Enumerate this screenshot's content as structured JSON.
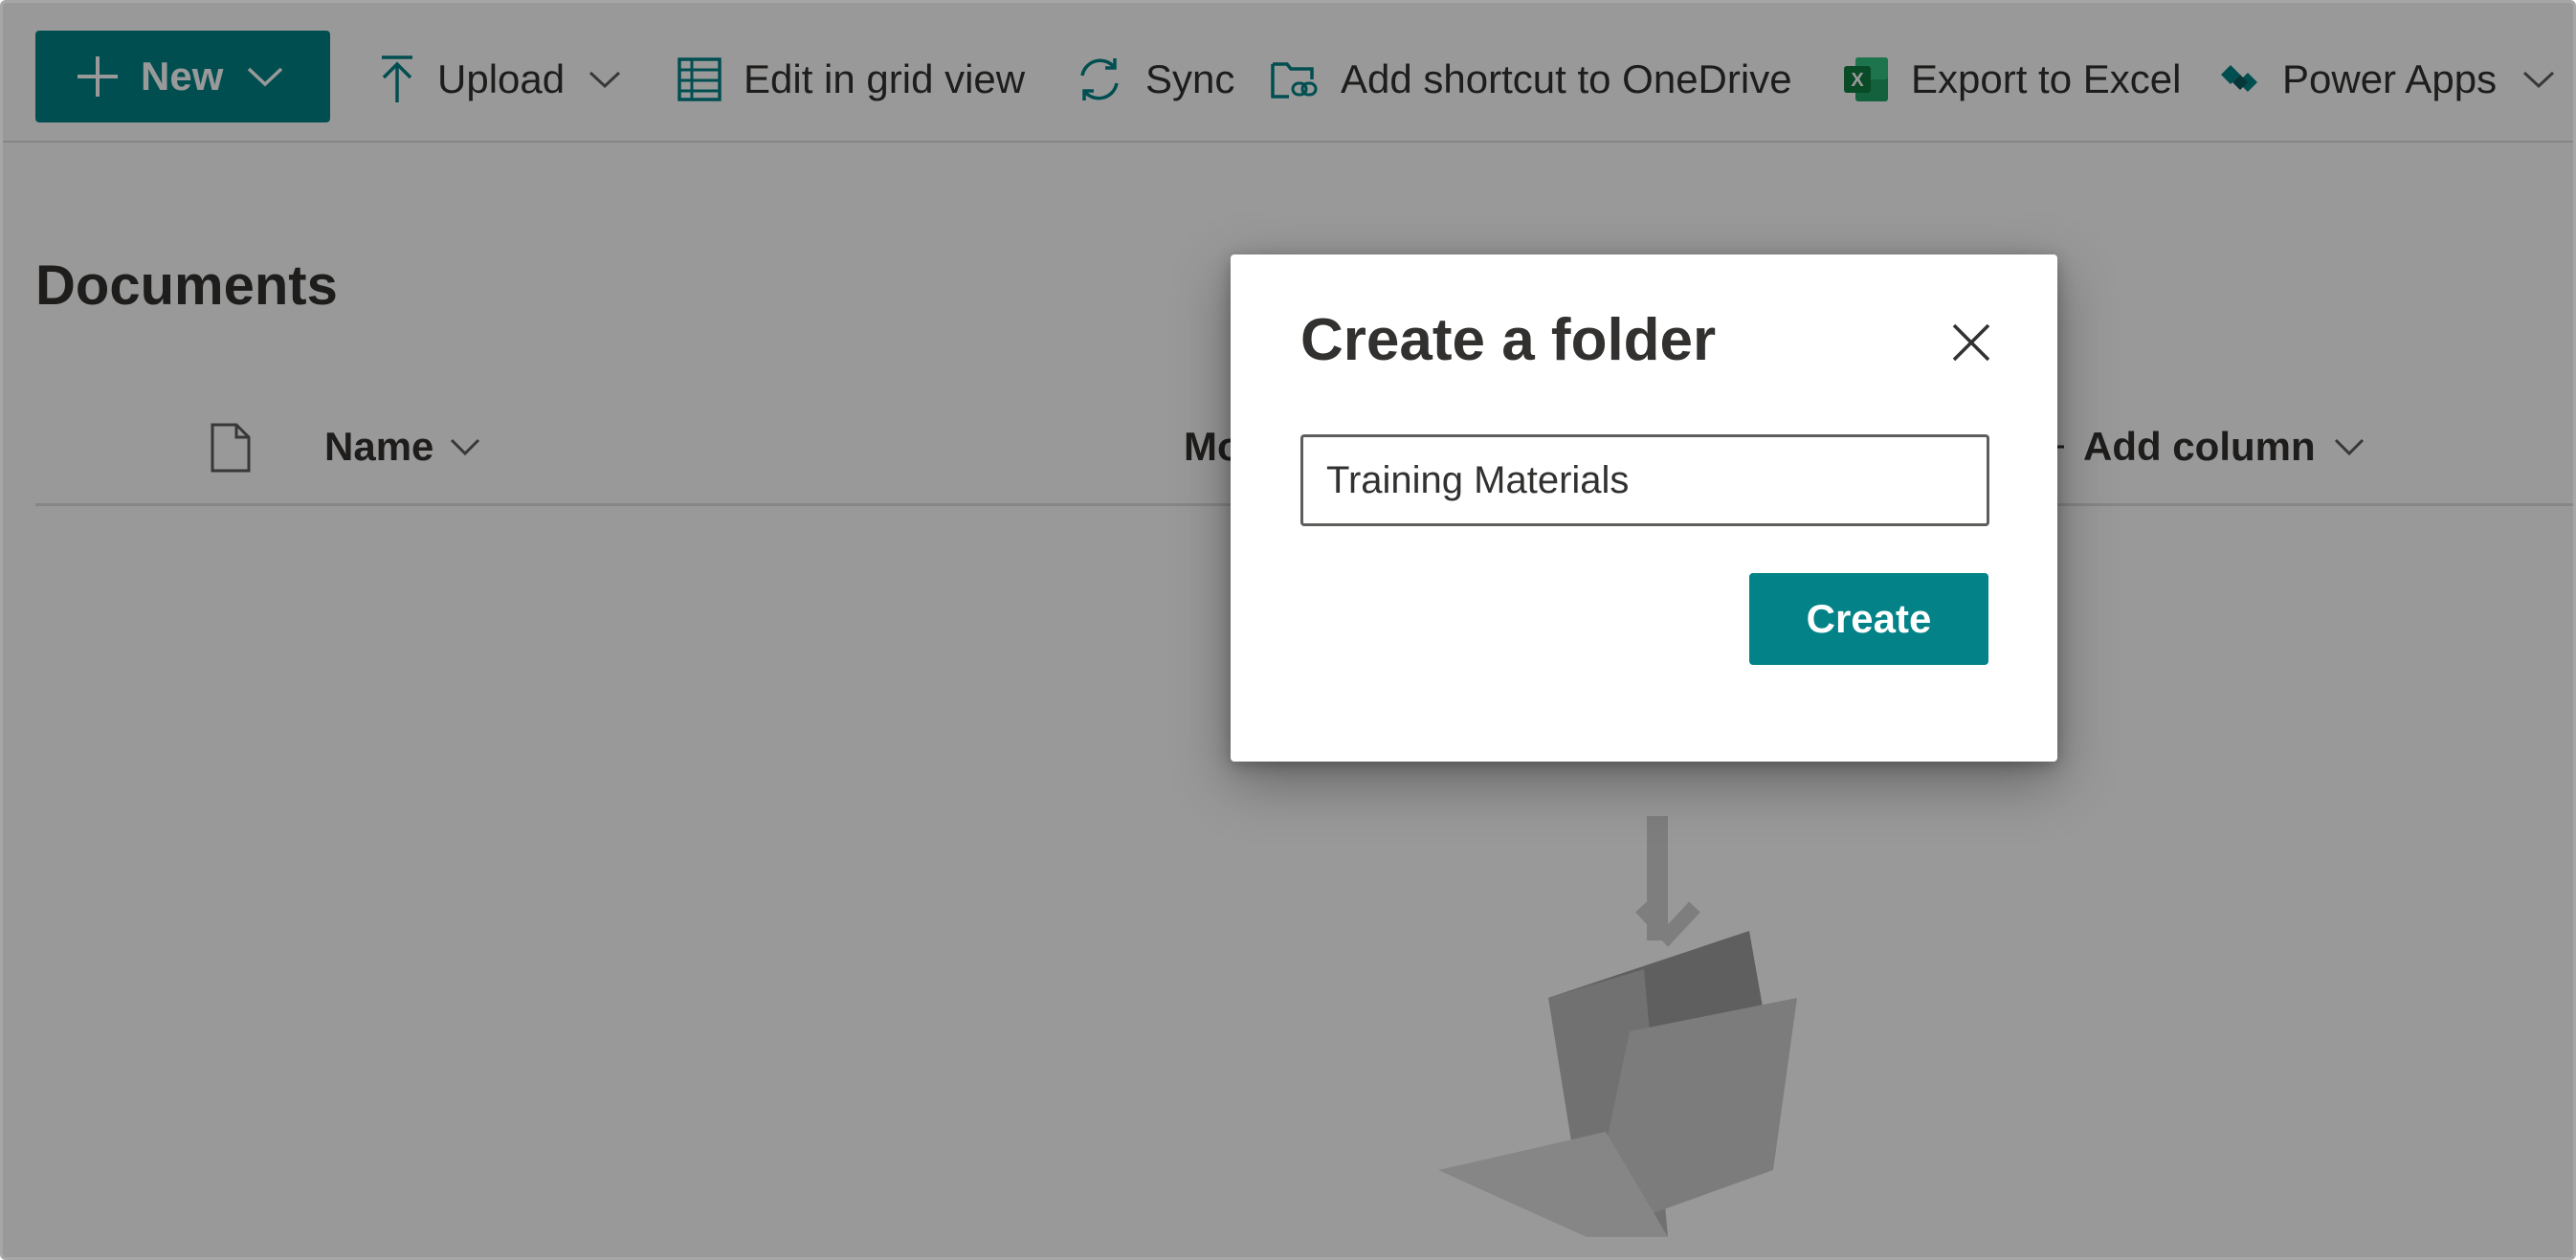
{
  "toolbar": {
    "new_label": "New",
    "upload_label": "Upload",
    "grid_view_label": "Edit in grid view",
    "sync_label": "Sync",
    "shortcut_label": "Add shortcut to OneDrive",
    "excel_label": "Export to Excel",
    "power_apps_label": "Power Apps"
  },
  "library": {
    "title": "Documents",
    "columns": {
      "name": "Name",
      "modified_partial": "Mo",
      "add_column": "Add column"
    }
  },
  "dialog": {
    "title": "Create a folder",
    "input_value": "Training Materials",
    "create_label": "Create"
  },
  "colors": {
    "accent": "#038387",
    "excel_green": "#107c41",
    "overlay": "rgba(0,0,0,0.4)"
  },
  "icons": {
    "new": "plus-icon",
    "upload": "upload-arrow-icon",
    "grid": "grid-table-icon",
    "sync": "sync-icon",
    "shortcut": "onedrive-shortcut-icon",
    "excel": "excel-icon",
    "power_apps": "power-apps-icon",
    "close": "close-icon",
    "file": "file-icon"
  }
}
